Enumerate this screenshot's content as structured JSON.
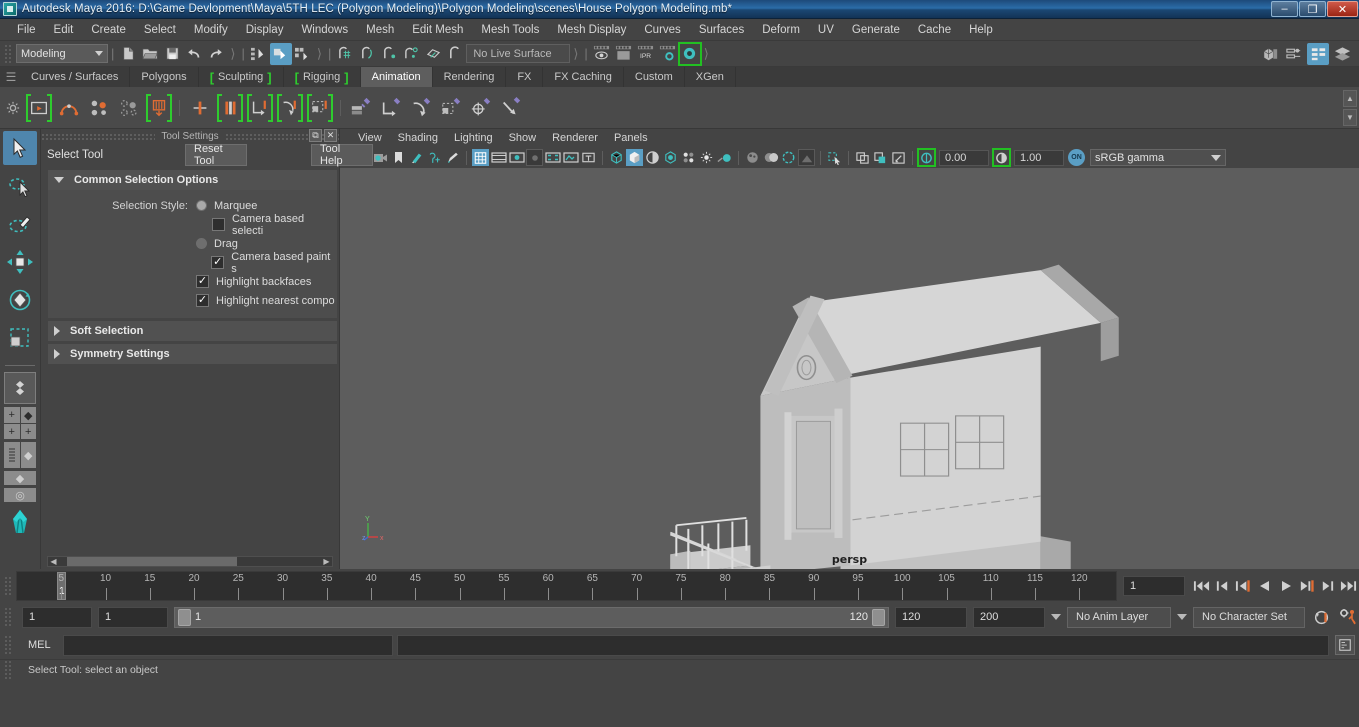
{
  "window": {
    "title": "Autodesk Maya 2016: D:\\Game Devlopment\\Maya\\5TH LEC (Polygon Modeling)\\Polygon Modeling\\scenes\\House Polygon Modeling.mb*",
    "minimize": "–",
    "restore": "❐",
    "close": "✕"
  },
  "menubar": {
    "items": [
      {
        "label": "File"
      },
      {
        "label": "Edit"
      },
      {
        "label": "Create"
      },
      {
        "label": "Select"
      },
      {
        "label": "Modify"
      },
      {
        "label": "Display"
      },
      {
        "label": "Windows"
      },
      {
        "label": "Mesh"
      },
      {
        "label": "Edit Mesh"
      },
      {
        "label": "Mesh Tools"
      },
      {
        "label": "Mesh Display"
      },
      {
        "label": "Curves"
      },
      {
        "label": "Surfaces"
      },
      {
        "label": "Deform"
      },
      {
        "label": "UV"
      },
      {
        "label": "Generate"
      },
      {
        "label": "Cache"
      },
      {
        "label": "Help"
      }
    ]
  },
  "statusbar": {
    "menuset": "Modeling",
    "live_surface": "No Live Surface",
    "render_ipr_label": "IPR"
  },
  "shelf": {
    "tabs": [
      {
        "label": "Curves / Surfaces",
        "active": false,
        "bracket": false
      },
      {
        "label": "Polygons",
        "active": false,
        "bracket": false
      },
      {
        "label": "Sculpting",
        "active": false,
        "bracket": true
      },
      {
        "label": "Rigging",
        "active": false,
        "bracket": true
      },
      {
        "label": "Animation",
        "active": true,
        "bracket": false
      },
      {
        "label": "Rendering",
        "active": false,
        "bracket": false
      },
      {
        "label": "FX",
        "active": false,
        "bracket": false
      },
      {
        "label": "FX Caching",
        "active": false,
        "bracket": false
      },
      {
        "label": "Custom",
        "active": false,
        "bracket": false
      },
      {
        "label": "XGen",
        "active": false,
        "bracket": false
      }
    ]
  },
  "toolsettings": {
    "panel_title": "Tool Settings",
    "tool_name": "Select Tool",
    "reset_label": "Reset Tool",
    "help_label": "Tool Help",
    "frames": [
      {
        "label": "Common Selection Options",
        "expanded": true
      },
      {
        "label": "Soft Selection",
        "expanded": false
      },
      {
        "label": "Symmetry Settings",
        "expanded": false
      }
    ],
    "selection_style_label": "Selection Style:",
    "options": [
      {
        "label": "Marquee",
        "type": "radio",
        "checked": false
      },
      {
        "label": "Camera based selecti",
        "type": "checkbox",
        "checked": false
      },
      {
        "label": "Drag",
        "type": "radio",
        "checked": true
      },
      {
        "label": "Camera based paint s",
        "type": "checkbox",
        "checked": true
      },
      {
        "label": "Highlight backfaces",
        "type": "checkbox",
        "checked": true
      },
      {
        "label": "Highlight nearest compo",
        "type": "checkbox",
        "checked": true
      }
    ]
  },
  "viewport": {
    "menus": [
      {
        "label": "View"
      },
      {
        "label": "Shading"
      },
      {
        "label": "Lighting"
      },
      {
        "label": "Show"
      },
      {
        "label": "Renderer"
      },
      {
        "label": "Panels"
      }
    ],
    "exposure_value": "0.00",
    "gamma_value": "1.00",
    "color_profile": "sRGB gamma",
    "on_badge": "ON",
    "camera_label": "persp",
    "axis_y": "Y",
    "axis_x": "x",
    "axis_z": "z"
  },
  "timeline": {
    "ticks": [
      5,
      10,
      15,
      20,
      25,
      30,
      35,
      40,
      45,
      50,
      55,
      60,
      65,
      70,
      75,
      80,
      85,
      90,
      95,
      100,
      105,
      110,
      115,
      120
    ],
    "current_frame_marker": "1",
    "current_frame_field": "1"
  },
  "range": {
    "anim_start": "1",
    "range_start": "1",
    "slider_start_label": "1",
    "slider_end_label": "120",
    "range_end": "120",
    "anim_end": "200",
    "anim_layer": "No Anim Layer",
    "character_set": "No Character Set"
  },
  "commandline": {
    "language": "MEL",
    "input_value": "",
    "output_value": ""
  },
  "helpline": {
    "text": "Select Tool: select an object"
  },
  "colors": {
    "accent_blue": "#5a9ec4",
    "shelf_green": "#2ecc2e",
    "orange": "#e06c33",
    "teal": "#3fbfbf",
    "panel_bg": "#444444",
    "viewport_bg": "#5d5d5d"
  }
}
